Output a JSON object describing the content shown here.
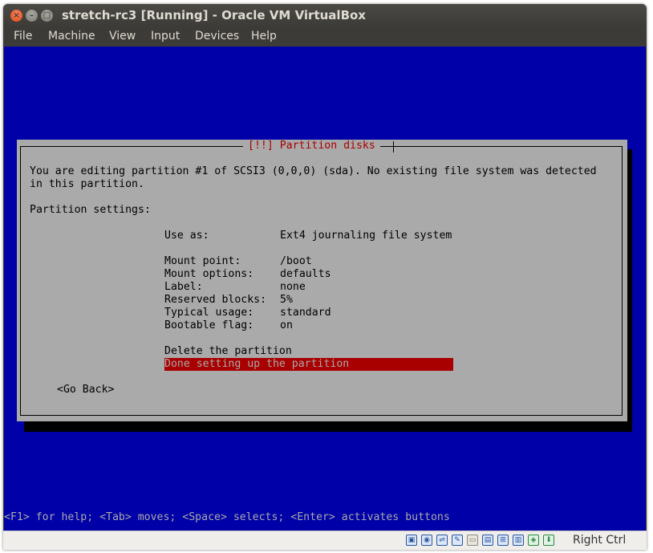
{
  "window": {
    "title": "stretch-rc3 [Running] - Oracle VM VirtualBox"
  },
  "menu": [
    "File",
    "Machine",
    "View",
    "Input",
    "Devices",
    "Help"
  ],
  "dialog": {
    "title": "[!!] Partition disks",
    "intro_line1": "You are editing partition #1 of SCSI3 (0,0,0) (sda). No existing file system was detected",
    "intro_line2": "in this partition.",
    "settings_heading": "Partition settings:",
    "use_as": {
      "label": "Use as:",
      "value": "Ext4 journaling file system"
    },
    "settings": [
      {
        "label": "Mount point:",
        "value": "/boot"
      },
      {
        "label": "Mount options:",
        "value": "defaults"
      },
      {
        "label": "Label:",
        "value": "none"
      },
      {
        "label": "Reserved blocks:",
        "value": "5%"
      },
      {
        "label": "Typical usage:",
        "value": "standard"
      },
      {
        "label": "Bootable flag:",
        "value": "on"
      }
    ],
    "delete_option": "Delete the partition",
    "done_option": "Done setting up the partition",
    "go_back": "<Go Back>"
  },
  "help_line": "<F1> for help; <Tab> moves; <Space> selects; <Enter> activates buttons",
  "status_bar": {
    "icons": [
      "hard-disk-icon",
      "optical-disk-icon",
      "usb-icon",
      "edit-icon",
      "shared-folder-icon",
      "display-icon",
      "network-icon",
      "video-capture-icon",
      "cpu-icon",
      "mouse-integration-icon"
    ],
    "host_key": "Right Ctrl"
  },
  "colors": {
    "screen_bg": "#0000a8",
    "dialog_bg": "#aaaaaa",
    "highlight": "#a80000",
    "title_text": "#a80000"
  }
}
